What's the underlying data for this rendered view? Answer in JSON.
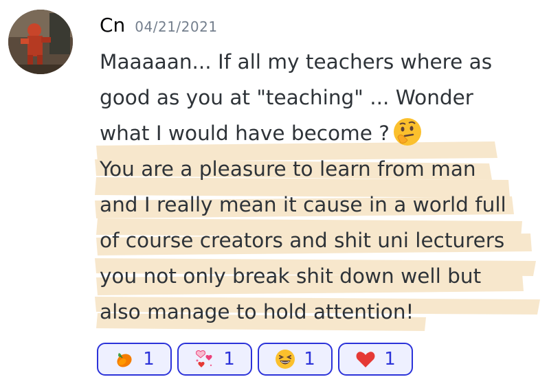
{
  "message": {
    "username": "Cn",
    "timestamp": "04/21/2021",
    "lines": [
      "Maaaaan... If all my teachers where as",
      "good as you at \"teaching\" ... Wonder",
      "what I would have become ?",
      "You are a pleasure to learn from man",
      "and I really mean it cause in a world full",
      "of course creators and shit uni lecturers",
      "you not only break shit down well but",
      "also manage to hold attention!"
    ],
    "inline_emoji": "thinking-face-icon"
  },
  "colors": {
    "reaction_border": "#2b32d9",
    "reaction_bg": "#eef0ff",
    "highlight": "#f6e3c4",
    "timestamp": "#747f8d"
  },
  "reactions": [
    {
      "icon": "mango-icon",
      "count": "1"
    },
    {
      "icon": "hearts-icon",
      "count": "1"
    },
    {
      "icon": "laughing-face-icon",
      "count": "1"
    },
    {
      "icon": "red-heart-icon",
      "count": "1"
    }
  ]
}
